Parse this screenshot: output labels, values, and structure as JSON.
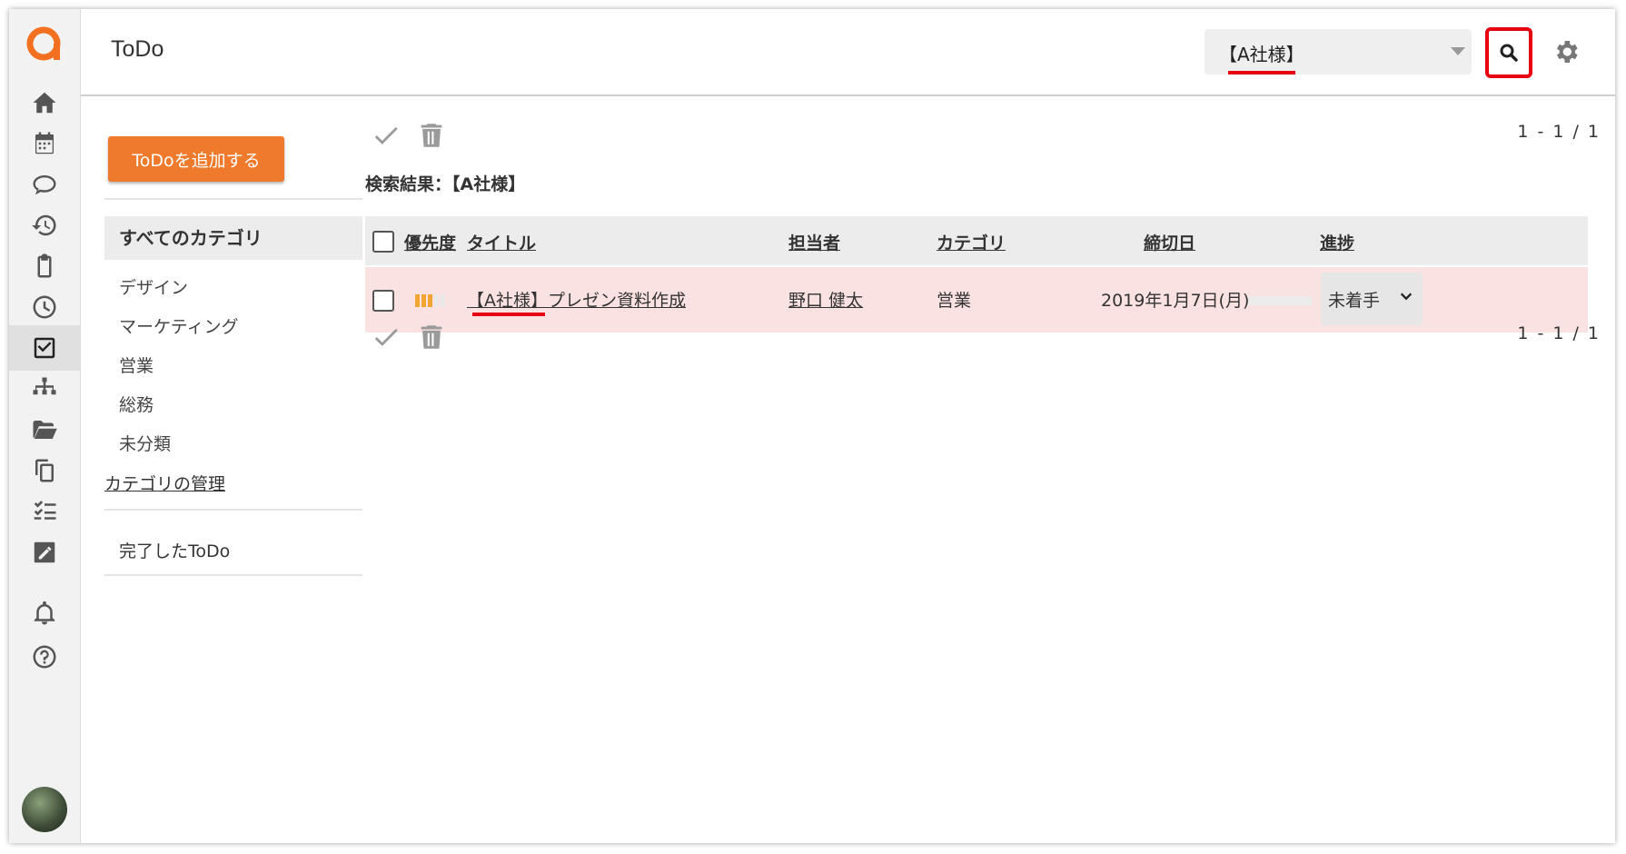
{
  "app": {
    "title": "ToDo"
  },
  "search": {
    "value": "【A社様】"
  },
  "sidebar_rail": {
    "items": [
      "home-icon",
      "calendar-icon",
      "chat-icon",
      "history-icon",
      "clipboard-icon",
      "clock-icon",
      "todo-check-icon",
      "org-chart-icon",
      "folder-icon",
      "copy-icon",
      "checklist-icon",
      "edit-icon",
      "bell-icon",
      "help-icon"
    ],
    "active": "todo-check-icon"
  },
  "left": {
    "add_button": "ToDoを追加する",
    "all_categories": "すべてのカテゴリ",
    "categories": [
      "デザイン",
      "マーケティング",
      "営業",
      "総務",
      "未分類"
    ],
    "manage_categories": "カテゴリの管理",
    "completed": "完了したToDo"
  },
  "main": {
    "pager_top": "1 - 1 / 1",
    "pager_bottom": "1 - 1 / 1",
    "search_result_label": "検索結果：【A社様】",
    "columns": {
      "priority": "優先度",
      "title": "タイトル",
      "assignee": "担当者",
      "category": "カテゴリ",
      "due": "締切日",
      "progress": "進捗"
    },
    "rows": [
      {
        "priority_level": 3,
        "priority_max": 5,
        "title": "【A社様】プレゼン資料作成",
        "assignee": "野口 健太",
        "category": "営業",
        "due": "2019年1月7日(月)",
        "progress_fraction": 0,
        "status": "未着手"
      }
    ]
  },
  "colors": {
    "accent": "#ef7a2b",
    "highlight_red": "#e60012",
    "row_bg": "#fbe2e2"
  }
}
